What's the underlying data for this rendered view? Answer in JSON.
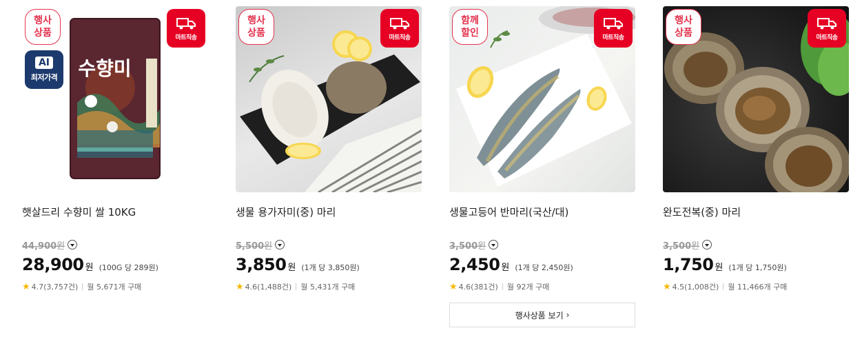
{
  "products": [
    {
      "promo_line1": "행사",
      "promo_line2": "상품",
      "delivery_label": "마트직송",
      "ai_top": "AI",
      "ai_bottom": "최저가격",
      "package_text": "수향미",
      "title": "햇살드리 수향미 쌀 10KG",
      "original_price": "44,900",
      "original_won": "원",
      "price": "28,900",
      "won": "원",
      "unit_price": "(100G 당 289원)",
      "rating": "4.7(3,757건)",
      "purchases": "월 5,671개 구매"
    },
    {
      "promo_line1": "행사",
      "promo_line2": "상품",
      "delivery_label": "마트직송",
      "title": "생물 용가자미(중) 마리",
      "original_price": "5,500",
      "original_won": "원",
      "price": "3,850",
      "won": "원",
      "unit_price": "(1개 당 3,850원)",
      "rating": "4.6(1,488건)",
      "purchases": "월 5,431개 구매"
    },
    {
      "promo_line1": "함께",
      "promo_line2": "할인",
      "delivery_label": "마트직송",
      "title": "생물고등어 반마리(국산/대)",
      "original_price": "3,500",
      "original_won": "원",
      "price": "2,450",
      "won": "원",
      "unit_price": "(1개 당 2,450원)",
      "rating": "4.6(381건)",
      "purchases": "월 92개 구매"
    },
    {
      "promo_line1": "행사",
      "promo_line2": "상품",
      "delivery_label": "마트직송",
      "title": "완도전복(중) 마리",
      "original_price": "3,500",
      "original_won": "원",
      "price": "1,750",
      "won": "원",
      "unit_price": "(1개 당 1,750원)",
      "rating": "4.5(1,008건)",
      "purchases": "월 11,466개 구매"
    }
  ],
  "more_button": "행사상품 보기",
  "colors": {
    "accent": "#e60023",
    "promo_border": "#e4314c",
    "star": "#f5b800",
    "ai_badge": "#1d3a6e"
  },
  "icons": {
    "delivery": "truck-icon",
    "rating": "star-icon",
    "info": "chevron-down-circle-icon",
    "more": "chevron-right-icon"
  }
}
